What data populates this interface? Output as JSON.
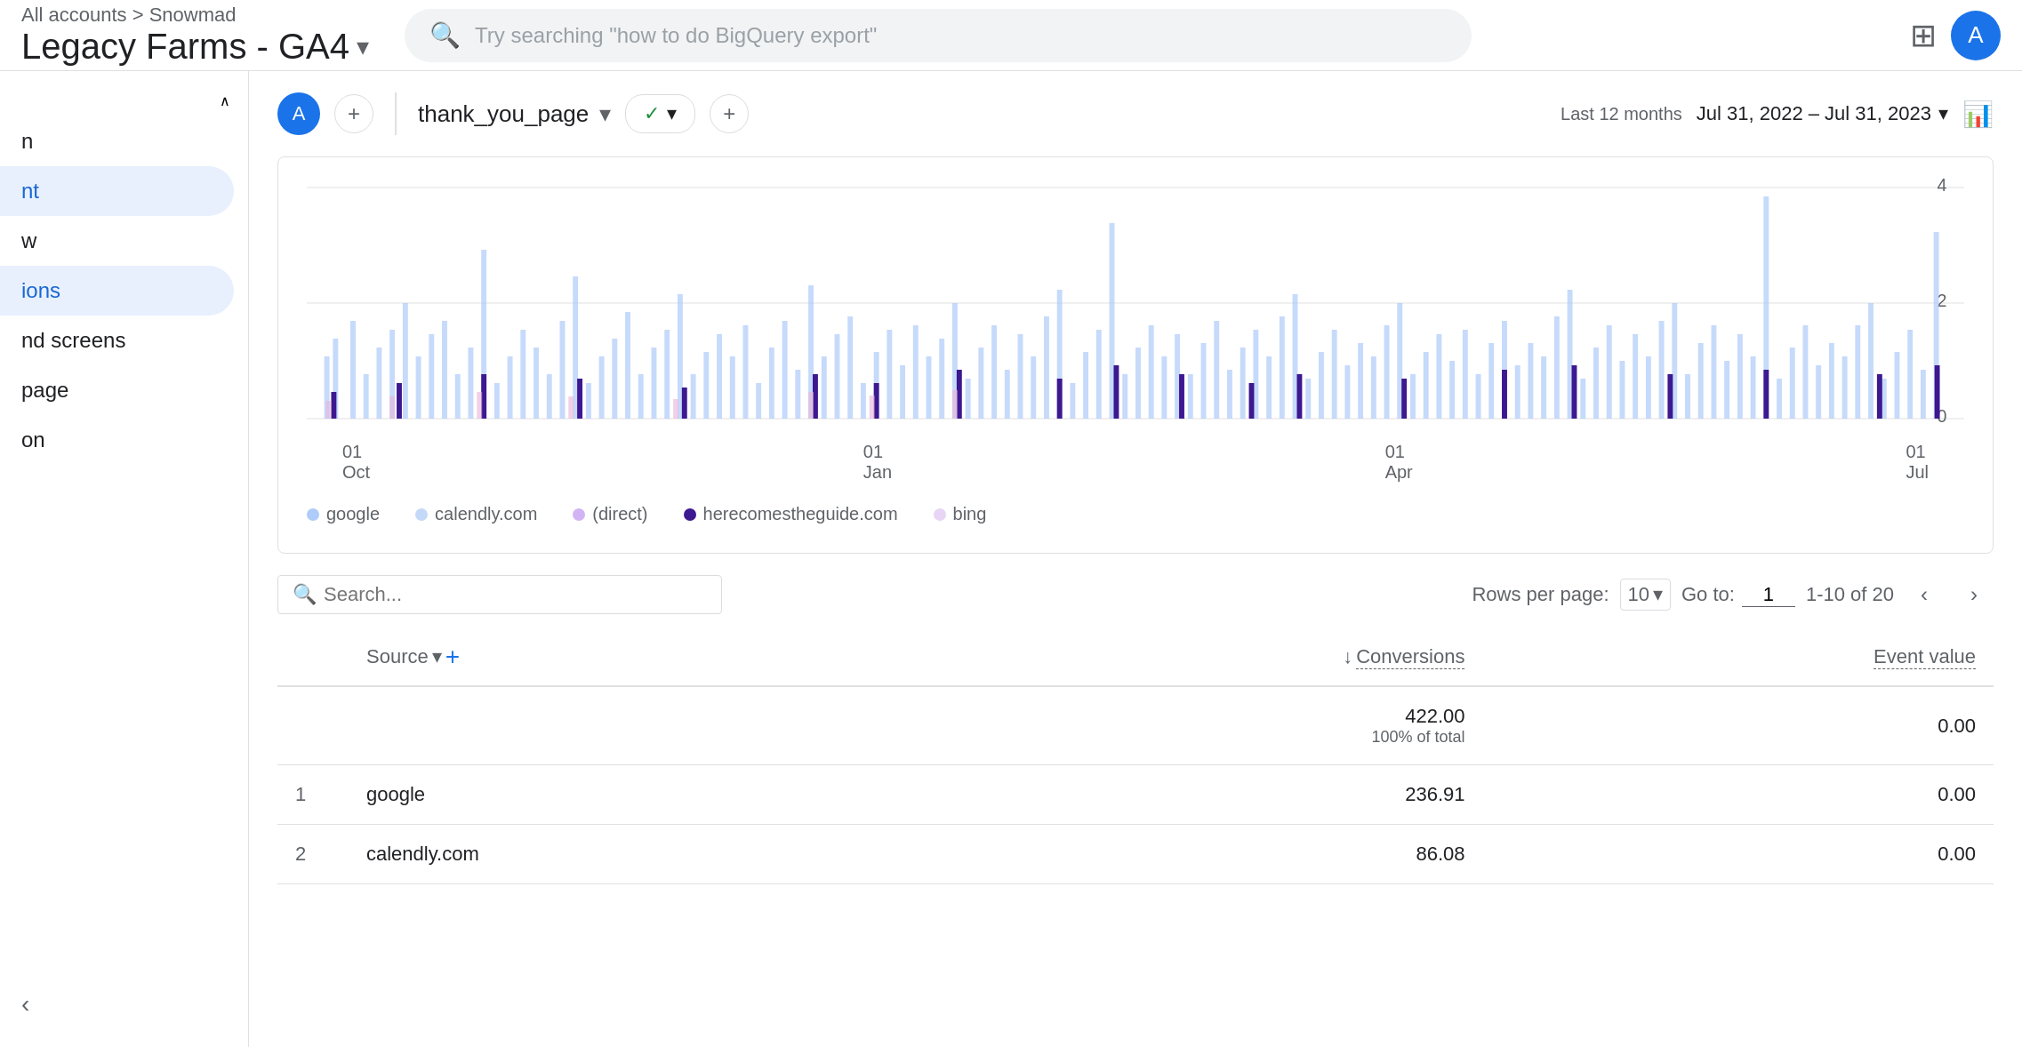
{
  "header": {
    "breadcrumb": "All accounts > Snowmad",
    "app_title": "Legacy Farms - GA4",
    "dropdown_arrow": "▾",
    "search_placeholder": "Try searching \"how to do BigQuery export\"",
    "avatar_label": "A"
  },
  "segment_bar": {
    "segment_label": "thank_you_page",
    "check_icon": "✓",
    "filter_icon": "▾",
    "add_icon": "+",
    "date_label": "Last 12 months",
    "date_range": "Jul 31, 2022 – Jul 31, 2023",
    "date_arrow": "▾"
  },
  "chart": {
    "y_axis": [
      "4",
      "2",
      "0"
    ],
    "x_axis": [
      "01\nOct",
      "01\nJan",
      "01\nApr",
      "01\nJul"
    ],
    "legend": [
      {
        "label": "google",
        "color": "#aecbfa"
      },
      {
        "label": "calendly.com",
        "color": "#c4d8f8"
      },
      {
        "label": "(direct)",
        "color": "#d2b4f5"
      },
      {
        "label": "herecomestheguide.com",
        "color": "#3c1891"
      },
      {
        "label": "bing",
        "color": "#e8d5f5"
      }
    ]
  },
  "table_controls": {
    "search_placeholder": "Search...",
    "rows_label": "Rows per page:",
    "rows_value": "10",
    "goto_label": "Go to:",
    "goto_value": "1",
    "pagination_info": "1-10 of 20"
  },
  "table": {
    "columns": [
      {
        "key": "num",
        "label": "",
        "align": "left"
      },
      {
        "key": "source",
        "label": "Source",
        "align": "left",
        "sortable": false,
        "has_dropdown": true
      },
      {
        "key": "conversions",
        "label": "Conversions",
        "align": "right",
        "sortable": true,
        "sort_icon": "↓"
      },
      {
        "key": "event_value",
        "label": "Event value",
        "align": "right",
        "sortable": false
      }
    ],
    "totals": {
      "conversions": "422.00",
      "conversions_sub": "100% of total",
      "event_value": "0.00"
    },
    "rows": [
      {
        "num": "1",
        "source": "google",
        "conversions": "236.91",
        "event_value": "0.00"
      },
      {
        "num": "2",
        "source": "calendly.com",
        "conversions": "86.08",
        "event_value": "0.00"
      }
    ]
  },
  "sidebar": {
    "collapse_icon": "∧",
    "items": [
      {
        "label": "n",
        "active": false
      },
      {
        "label": "nt",
        "active": false
      },
      {
        "label": "w",
        "active": false
      },
      {
        "label": "ions",
        "active": true
      },
      {
        "label": "nd screens",
        "active": false
      },
      {
        "label": "page",
        "active": false
      },
      {
        "label": "on",
        "active": false
      }
    ],
    "chevron_icon": "‹"
  }
}
